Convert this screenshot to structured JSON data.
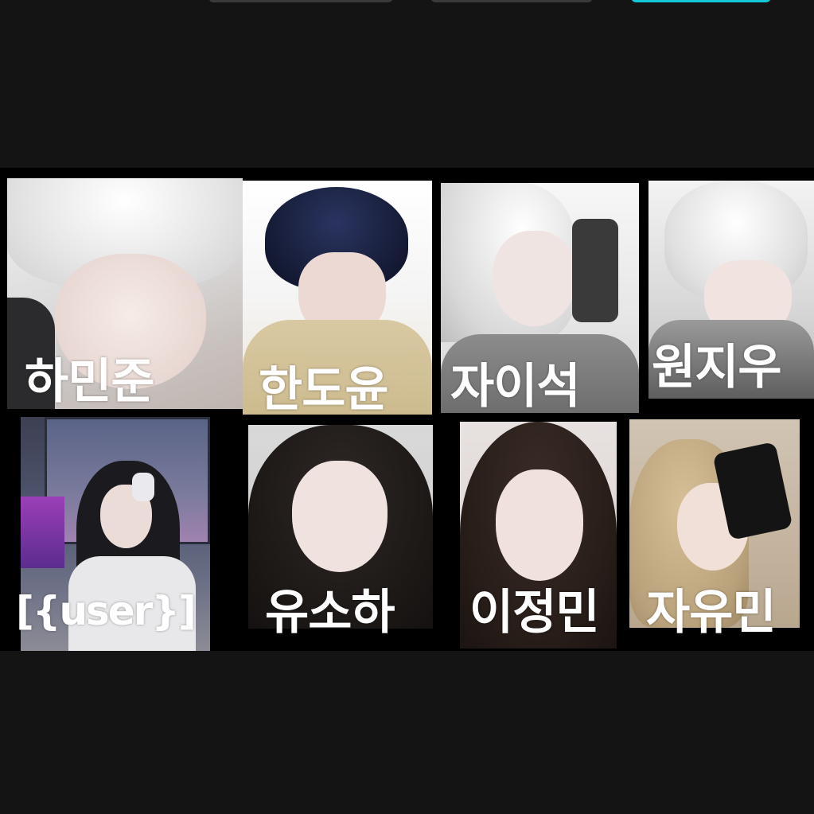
{
  "characters": [
    {
      "name": "하민준"
    },
    {
      "name": "한도윤"
    },
    {
      "name": "자이석"
    },
    {
      "name": "원지우"
    },
    {
      "name": "[{user}]"
    },
    {
      "name": "유소하"
    },
    {
      "name": "이정민"
    },
    {
      "name": "자유민"
    }
  ]
}
